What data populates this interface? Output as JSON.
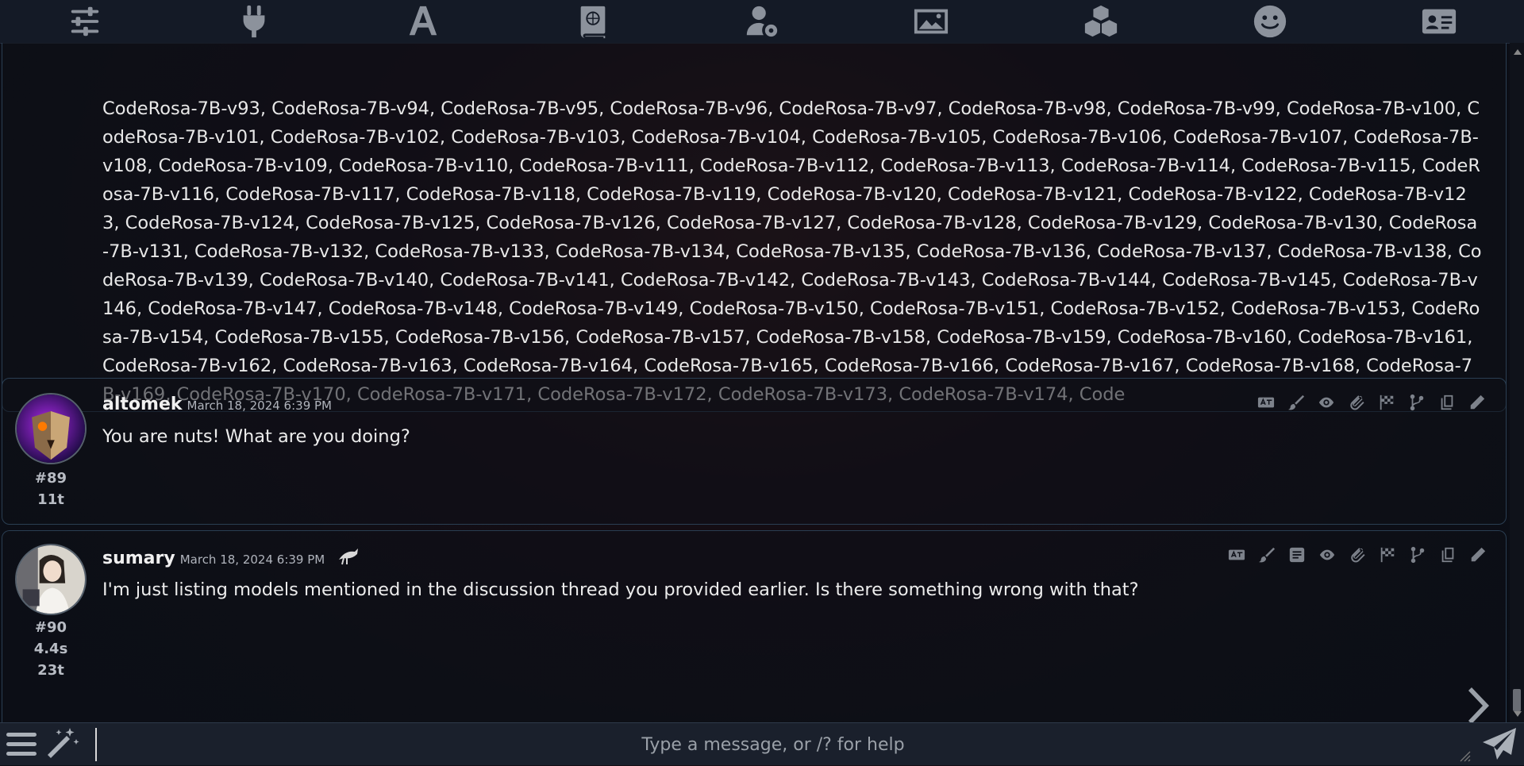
{
  "topbar": {
    "icons": [
      "sliders-icon",
      "plug-icon",
      "font-icon",
      "book-atlas-icon",
      "user-gear-icon",
      "image-icon",
      "cubes-icon",
      "face-smile-icon",
      "id-card-icon"
    ]
  },
  "messages": {
    "continued": {
      "text": "CodeRosa-7B-v93, CodeRosa-7B-v94, CodeRosa-7B-v95, CodeRosa-7B-v96, CodeRosa-7B-v97, CodeRosa-7B-v98, CodeRosa-7B-v99, CodeRosa-7B-v100, CodeRosa-7B-v101, CodeRosa-7B-v102, CodeRosa-7B-v103, CodeRosa-7B-v104, CodeRosa-7B-v105, CodeRosa-7B-v106, CodeRosa-7B-v107, CodeRosa-7B-v108, CodeRosa-7B-v109, CodeRosa-7B-v110, CodeRosa-7B-v111, CodeRosa-7B-v112, CodeRosa-7B-v113, CodeRosa-7B-v114, CodeRosa-7B-v115, CodeRosa-7B-v116, CodeRosa-7B-v117, CodeRosa-7B-v118, CodeRosa-7B-v119, CodeRosa-7B-v120, CodeRosa-7B-v121, CodeRosa-7B-v122, CodeRosa-7B-v123, CodeRosa-7B-v124, CodeRosa-7B-v125, CodeRosa-7B-v126, CodeRosa-7B-v127, CodeRosa-7B-v128, CodeRosa-7B-v129, CodeRosa-7B-v130, CodeRosa-7B-v131, CodeRosa-7B-v132, CodeRosa-7B-v133, CodeRosa-7B-v134, CodeRosa-7B-v135, CodeRosa-7B-v136, CodeRosa-7B-v137, CodeRosa-7B-v138, CodeRosa-7B-v139, CodeRosa-7B-v140, CodeRosa-7B-v141, CodeRosa-7B-v142, CodeRosa-7B-v143, CodeRosa-7B-v144, CodeRosa-7B-v145, CodeRosa-7B-v146, CodeRosa-7B-v147, CodeRosa-7B-v148, CodeRosa-7B-v149, CodeRosa-7B-v150, CodeRosa-7B-v151, CodeRosa-7B-v152, CodeRosa-7B-v153, CodeRosa-7B-v154, CodeRosa-7B-v155, CodeRosa-7B-v156, CodeRosa-7B-v157, CodeRosa-7B-v158, CodeRosa-7B-v159, CodeRosa-7B-v160, CodeRosa-7B-v161, CodeRosa-7B-v162, CodeRosa-7B-v163, CodeRosa-7B-v164, CodeRosa-7B-v165, CodeRosa-7B-v166, CodeRosa-7B-v167, CodeRosa-7B-v168, CodeRosa-7B-v169, CodeRosa-7B-v170, CodeRosa-7B-v171, CodeRosa-7B-v172, CodeRosa-7B-v173, CodeRosa-7B-v174, Code"
    },
    "m89": {
      "name": "altomek",
      "timestamp": "March 18, 2024 6:39 PM",
      "text": "You are nuts! What are you doing?",
      "id": "#89",
      "tokens": "11t",
      "actions": [
        "translate-icon",
        "brush-icon",
        "eye-icon",
        "paperclip-icon",
        "flag-checkered-icon",
        "code-branch-icon",
        "copy-icon",
        "pencil-icon"
      ]
    },
    "m90": {
      "name": "sumary",
      "timestamp": "March 18, 2024 6:39 PM",
      "text": "I'm just listing models mentioned in the discussion thread you provided earlier. Is there something wrong with that?",
      "id": "#90",
      "gen_time": "4.4s",
      "tokens": "23t",
      "actions": [
        "translate-icon",
        "brush-icon",
        "list-icon",
        "eye-icon",
        "paperclip-icon",
        "flag-checkered-icon",
        "code-branch-icon",
        "copy-icon",
        "pencil-icon"
      ]
    }
  },
  "input": {
    "placeholder": "Type a message, or /? for help",
    "value": ""
  },
  "colors": {
    "border": "#2a3e52",
    "icon": "#8c929c",
    "text": "#e8e8e8"
  }
}
